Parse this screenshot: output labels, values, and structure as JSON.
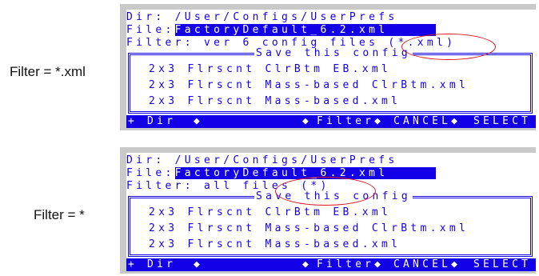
{
  "panels": [
    {
      "side_label": "Filter = *.xml",
      "dir_line": "Dir: /User/Configs/UserPrefs",
      "file_label": "File:",
      "file_value": "FactoryDefault_6.2.xml",
      "filter_line": "Filter: ver 6 config files (*.xml)",
      "box_title": "Save this config",
      "files": [
        "2x3 Flrscnt ClrBtm EB.xml",
        "2x3 Flrscnt Mass-based ClrBtm.xml",
        "2x3 Flrscnt Mass-based.xml"
      ],
      "status": {
        "dir": "+ Dir",
        "d1": "◆",
        "d2": "◆",
        "filter": "Filter◆",
        "cancel": "CANCEL◆",
        "select": "SELECT"
      }
    },
    {
      "side_label": "Filter = *",
      "dir_line": "Dir: /User/Configs/UserPrefs",
      "file_label": "File:",
      "file_value": "FactoryDefault_6.2.xml",
      "filter_line": "Filter: all files (*)",
      "box_title": "Save this config",
      "files": [
        "2x3 Flrscnt ClrBtm EB.xml",
        "2x3 Flrscnt Mass-based ClrBtm.xml",
        "2x3 Flrscnt Mass-based.xml"
      ],
      "status": {
        "dir": "+ Dir",
        "d1": "◆",
        "d2": "◆",
        "filter": "Filter◆",
        "cancel": "CANCEL◆",
        "select": "SELECT"
      }
    }
  ],
  "colors": {
    "text": "#1400e6",
    "highlight_bg": "#1400e6",
    "annotation": "#e0141e",
    "panel_bg": "#c9c9c9"
  }
}
